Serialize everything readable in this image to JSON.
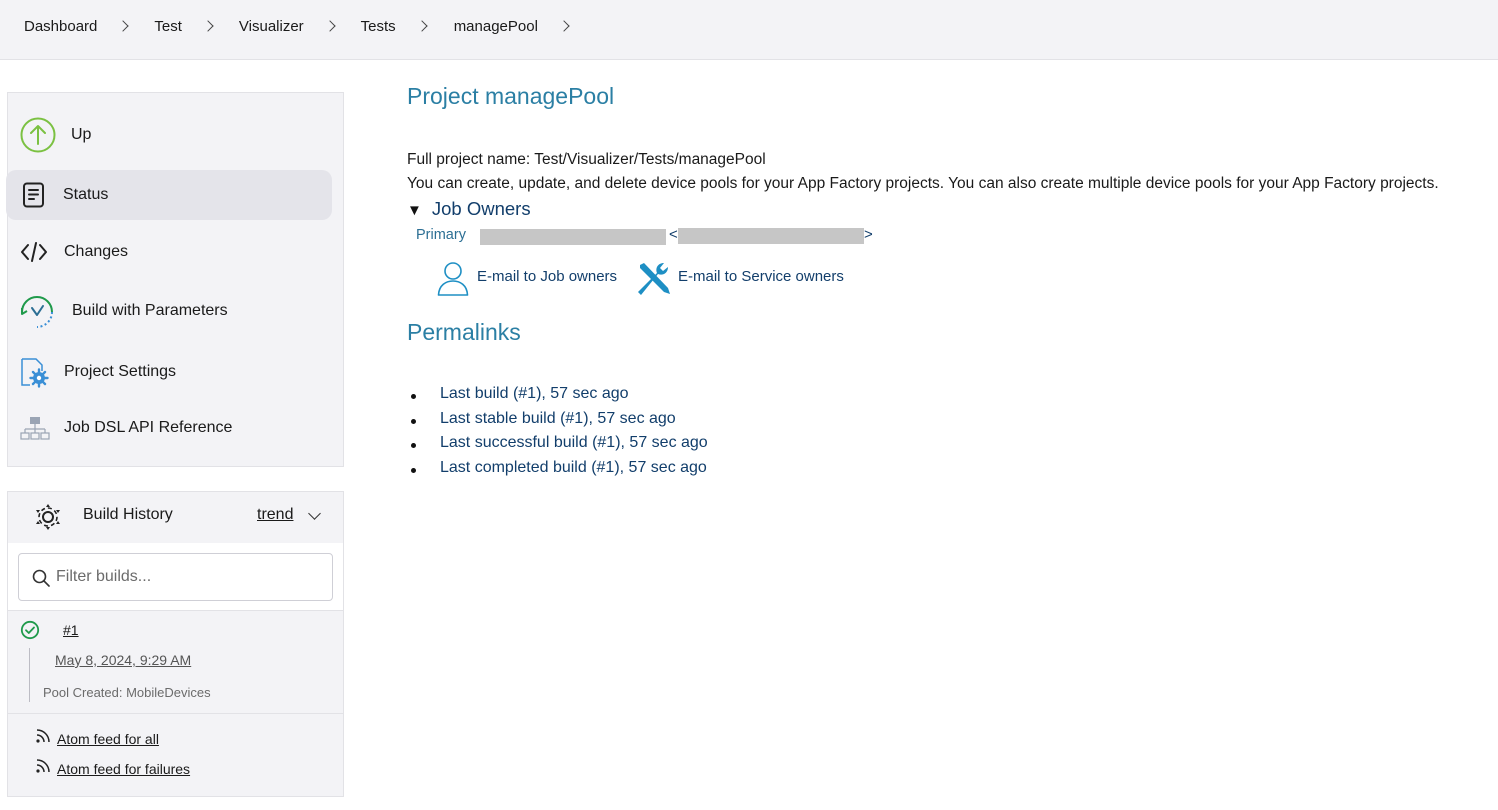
{
  "breadcrumb": {
    "items": [
      "Dashboard",
      "Test",
      "Visualizer",
      "Tests",
      "managePool"
    ]
  },
  "sidebar": {
    "items": [
      {
        "label": "Up",
        "icon": "arrow-up-circle-icon"
      },
      {
        "label": "Status",
        "icon": "document-icon",
        "active": true
      },
      {
        "label": "Changes",
        "icon": "code-icon"
      },
      {
        "label": "Build with Parameters",
        "icon": "build-params-icon"
      },
      {
        "label": "Project Settings",
        "icon": "settings-icon"
      },
      {
        "label": "Job DSL API Reference",
        "icon": "hierarchy-icon"
      }
    ]
  },
  "build_history": {
    "title": "Build History",
    "trend_label": "trend",
    "filter_placeholder": "Filter builds...",
    "builds": [
      {
        "number": "#1",
        "date": "May 8, 2024, 9:29 AM",
        "description": "Pool Created: MobileDevices",
        "status": "success"
      }
    ],
    "feeds": {
      "all": "Atom feed for all",
      "failures": "Atom feed for failures"
    }
  },
  "main": {
    "title": "Project managePool",
    "full_name": "Full project name: Test/Visualizer/Tests/managePool",
    "description": "You can create, update, and delete device pools for your App Factory projects. You can also create multiple device pools for your App Factory projects.",
    "owners": {
      "toggle_label": "Job Owners",
      "primary_label": "Primary",
      "email_job_owners": "E-mail to Job owners",
      "email_service_owners": "E-mail to Service owners"
    },
    "permalinks_title": "Permalinks",
    "permalinks": [
      "Last build (#1), 57 sec ago",
      "Last stable build (#1), 57 sec ago",
      "Last successful build (#1), 57 sec ago",
      "Last completed build (#1), 57 sec ago"
    ]
  },
  "colors": {
    "accent_title": "#2b7fa4",
    "link": "#123e6b",
    "success": "#1f9a4b",
    "up_icon": "#7bc142",
    "settings_icon": "#3a8fd6"
  }
}
